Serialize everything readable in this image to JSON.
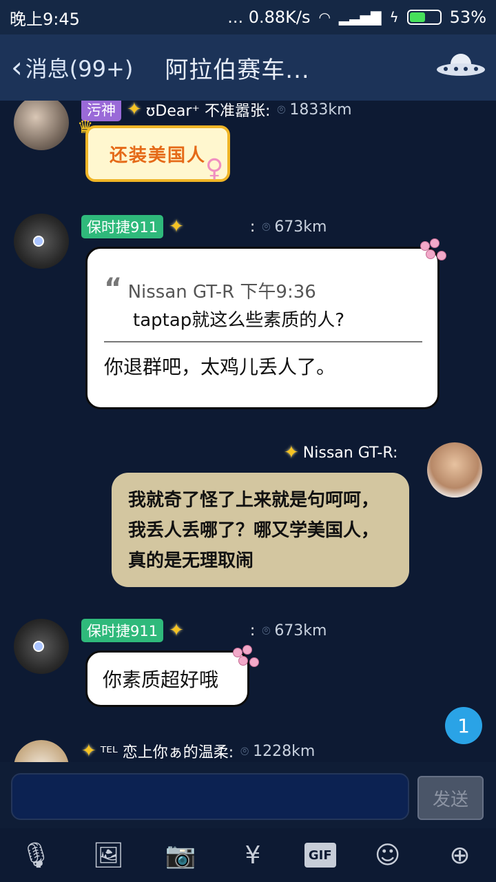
{
  "status": {
    "time": "晚上9:45",
    "network": "... 0.88K/s",
    "battery": "53%"
  },
  "nav": {
    "back_label": "消息(99+)",
    "title": "阿拉伯赛车..."
  },
  "messages": [
    {
      "tag": "污神",
      "sender": "ʊDear⁺ 不准嚣张:",
      "distance": "1833km",
      "sticker_text": "还装美国人"
    },
    {
      "tag": "保时捷911",
      "sender": ":",
      "distance": "673km",
      "quote_sender": "Nissan GT-R 下午9:36",
      "quote_text": "taptap就这么些素质的人?",
      "text": "你退群吧，太鸡儿丢人了。"
    },
    {
      "sender": "Nissan GT-R:",
      "text": "我就奇了怪了上来就是句呵呵，我丢人丢哪了？哪又学美国人，真的是无理取闹"
    },
    {
      "tag": "保时捷911",
      "sender": ":",
      "distance": "673km",
      "text": "你素质超好哦"
    },
    {
      "sender": "ᵀᴱᴸ 恋上你ぁ的温柔:",
      "distance": "1228km"
    }
  ],
  "unread_badge": "1",
  "input": {
    "placeholder": "",
    "send_label": "发送"
  },
  "toolbar": {
    "gif_label": "GIF"
  }
}
